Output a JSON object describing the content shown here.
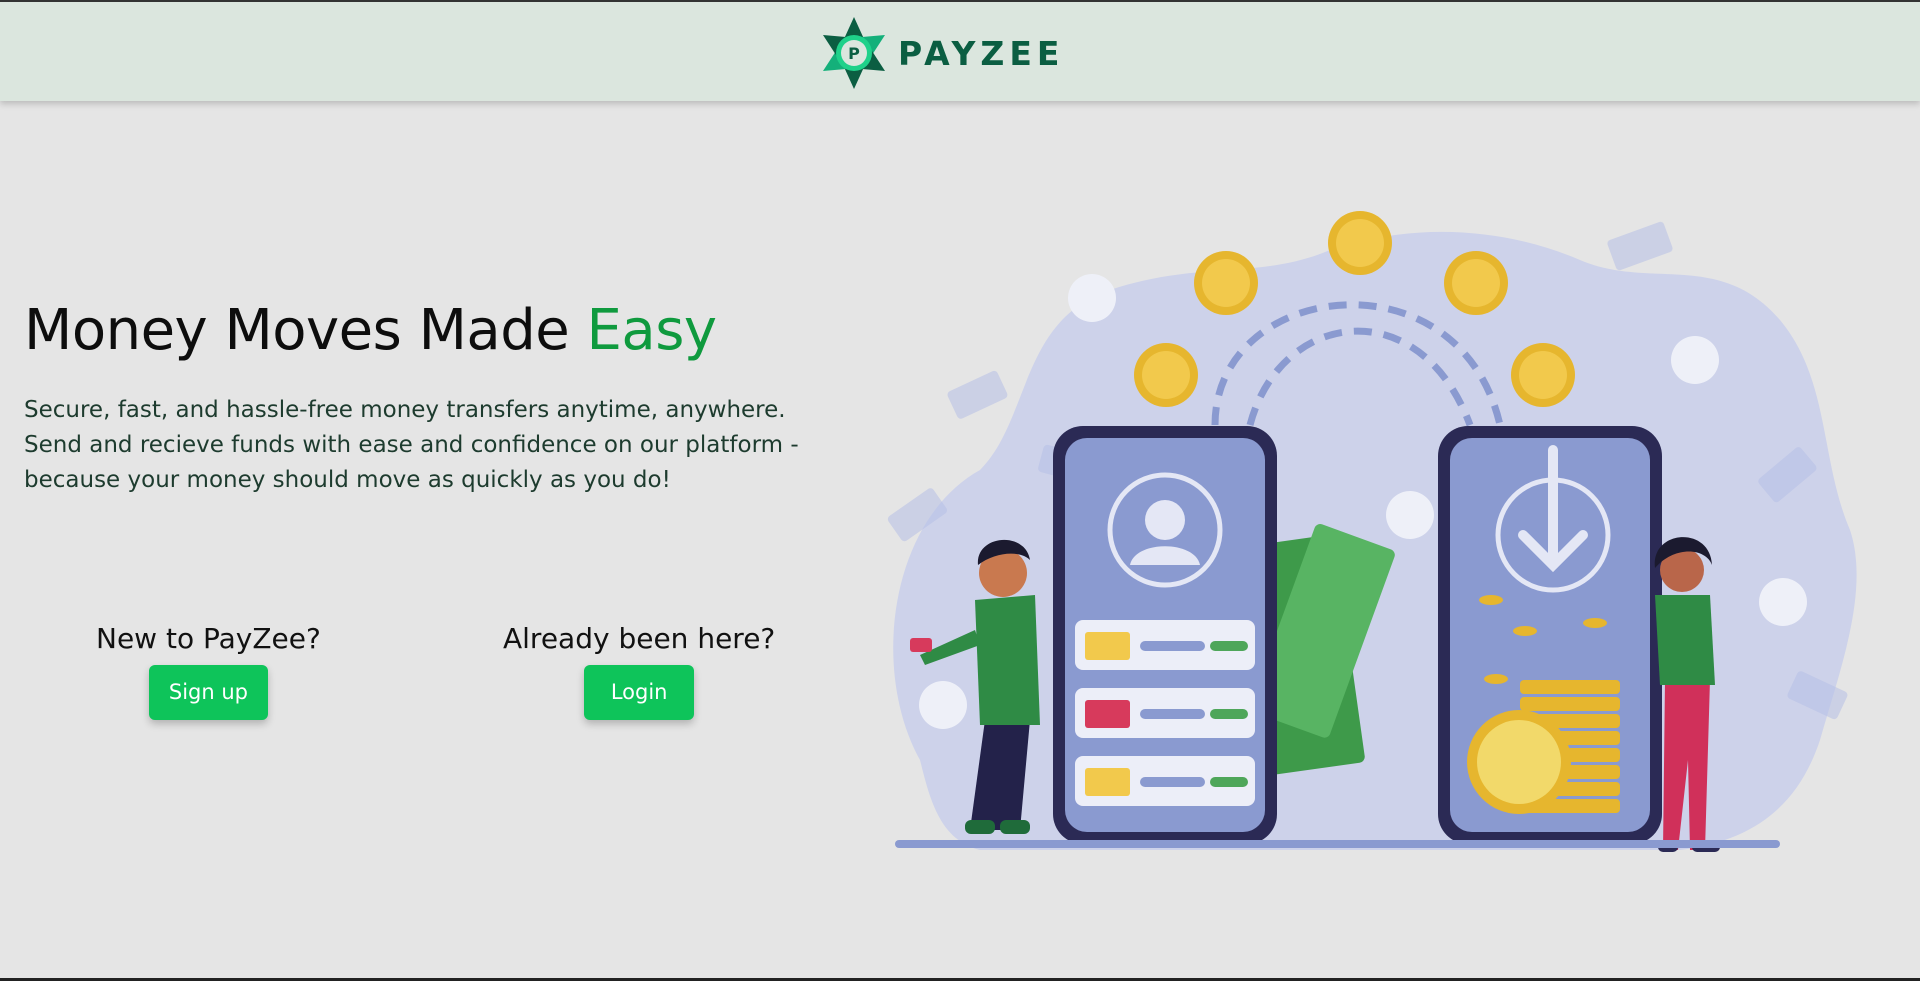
{
  "header": {
    "brand_name": "PAYZEE",
    "logo_letter": "P",
    "logo_icon": "payzee-star-logo"
  },
  "hero": {
    "title_main": "Money Moves Made ",
    "title_accent": "Easy",
    "description": "Secure, fast, and hassle-free money transfers anytime, anywhere. Send and recieve funds with ease and confidence on our platform - because your money should move as quickly as you do!"
  },
  "signup": {
    "label": "New to PayZee?",
    "button": "Sign up"
  },
  "login": {
    "label": "Already been here?",
    "button": "Login"
  },
  "illustration": {
    "subject": "money-transfer-between-phones"
  },
  "colors": {
    "brand": "#0b5e42",
    "accent": "#0f9a3e",
    "button": "#0ec45a",
    "header_bg": "#dbe6de",
    "page_bg": "#e5e5e5"
  }
}
